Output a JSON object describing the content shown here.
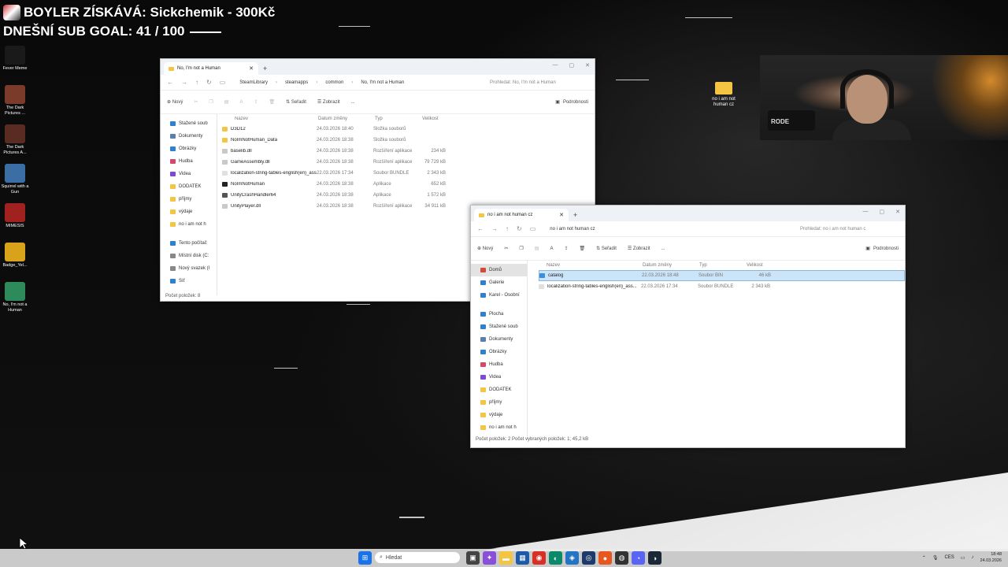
{
  "overlay": {
    "line1": "BOYLER ZÍSKÁVÁ: Sickchemik - 300Kč",
    "line2": "DNEŠNÍ SUB GOAL: 41 / 100"
  },
  "desktop": {
    "icons": [
      {
        "label": "Fever Meme",
        "color": "#1a1a1a"
      },
      {
        "label": "The Dark Pictures ...",
        "color": "#7a3b2a"
      },
      {
        "label": "The Dark Pictures A...",
        "color": "#5a2b22"
      },
      {
        "label": "Squirrel with a Gun",
        "color": "#3a6ea5"
      },
      {
        "label": "MIMESIS",
        "color": "#a12020"
      },
      {
        "label": "Badge_Yel...",
        "color": "#d8a21a"
      },
      {
        "label": "No, I'm not a Human",
        "color": "#2e8a5a"
      }
    ],
    "folder": {
      "label": "no i am not human cz"
    }
  },
  "webcam": {
    "mic_label": "RODE"
  },
  "window1": {
    "tab_title": "No, I'm not a Human",
    "path": [
      "SteamLibrary",
      "steamapps",
      "common",
      "No, I'm not a Human"
    ],
    "search_placeholder": "Prohledat: No, I'm not a Human",
    "toolbar": {
      "new": "Nový",
      "sort": "Seřadit",
      "view": "Zobrazit",
      "more": "...",
      "details": "Podrobnosti"
    },
    "nav": [
      {
        "label": "Stažené soub",
        "color": "#2f80d1"
      },
      {
        "label": "Dokumenty",
        "color": "#5a7fa8"
      },
      {
        "label": "Obrázky",
        "color": "#2f80d1"
      },
      {
        "label": "Hudba",
        "color": "#d34a6a"
      },
      {
        "label": "Videa",
        "color": "#7c4ad3"
      },
      {
        "label": "DODATEK",
        "color": "#f4c542"
      },
      {
        "label": "příjmy",
        "color": "#f4c542"
      },
      {
        "label": "výdaje",
        "color": "#f4c542"
      },
      {
        "label": "no i am not h",
        "color": "#f4c542"
      },
      {
        "label": "Tento počítač",
        "color": "#2f80d1"
      },
      {
        "label": "Místní disk (C:",
        "color": "#888888"
      },
      {
        "label": "Nový svazek (I",
        "color": "#888888"
      },
      {
        "label": "Síť",
        "color": "#2f80d1"
      }
    ],
    "columns": {
      "name": "Název",
      "date": "Datum změny",
      "type": "Typ",
      "size": "Velikost"
    },
    "files": [
      {
        "name": "D3D12",
        "date": "24.03.2026 18:40",
        "type": "Složka souborů",
        "size": "",
        "color": "#f4c542"
      },
      {
        "name": "NoImNotHuman_Data",
        "date": "24.03.2026 18:38",
        "type": "Složka souborů",
        "size": "",
        "color": "#f4c542"
      },
      {
        "name": "baselib.dll",
        "date": "24.03.2026 18:38",
        "type": "Rozšíření aplikace",
        "size": "234 kB",
        "color": "#c9c9c9"
      },
      {
        "name": "GameAssembly.dll",
        "date": "24.03.2026 18:38",
        "type": "Rozšíření aplikace",
        "size": "79 729 kB",
        "color": "#c9c9c9"
      },
      {
        "name": "localization-string-tables-english(en)_ass...",
        "date": "22.03.2026 17:34",
        "type": "Soubor BUNDLE",
        "size": "2 343 kB",
        "color": "#e0e0e0"
      },
      {
        "name": "NoImNotHuman",
        "date": "24.03.2026 18:38",
        "type": "Aplikace",
        "size": "652 kB",
        "color": "#222222"
      },
      {
        "name": "UnityCrashHandler64",
        "date": "24.03.2026 18:38",
        "type": "Aplikace",
        "size": "1 572 kB",
        "color": "#555555"
      },
      {
        "name": "UnityPlayer.dll",
        "date": "24.03.2026 18:38",
        "type": "Rozšíření aplikace",
        "size": "34 911 kB",
        "color": "#c9c9c9"
      }
    ],
    "status": "Počet položek: 8"
  },
  "window2": {
    "tab_title": "no i am not human cz",
    "path": [
      "no i am not human cz"
    ],
    "search_placeholder": "Prohledat: no i am not human c",
    "toolbar": {
      "new": "Nový",
      "sort": "Seřadit",
      "view": "Zobrazit",
      "more": "...",
      "details": "Podrobnosti"
    },
    "nav": [
      {
        "label": "Domů",
        "color": "#d34a3a",
        "selected": true
      },
      {
        "label": "Galerie",
        "color": "#2f80d1"
      },
      {
        "label": "Karel - Osobní",
        "color": "#2f80d1"
      },
      {
        "label": "Plocha",
        "color": "#2f80d1"
      },
      {
        "label": "Stažené soub",
        "color": "#2f80d1"
      },
      {
        "label": "Dokumenty",
        "color": "#5a7fa8"
      },
      {
        "label": "Obrázky",
        "color": "#2f80d1"
      },
      {
        "label": "Hudba",
        "color": "#d34a6a"
      },
      {
        "label": "Videa",
        "color": "#7c4ad3"
      },
      {
        "label": "DODATEK",
        "color": "#f4c542"
      },
      {
        "label": "příjmy",
        "color": "#f4c542"
      },
      {
        "label": "výdaje",
        "color": "#f4c542"
      },
      {
        "label": "no i am not h",
        "color": "#f4c542"
      }
    ],
    "columns": {
      "name": "Název",
      "date": "Datum změny",
      "type": "Typ",
      "size": "Velikost"
    },
    "files": [
      {
        "name": "catalog",
        "date": "22.03.2026 18:48",
        "type": "Soubor BIN",
        "size": "46 kB",
        "color": "#3a8ee0",
        "selected": true
      },
      {
        "name": "localization-string-tables-english(en)_ass...",
        "date": "22.03.2026 17:34",
        "type": "Soubor BUNDLE",
        "size": "2 343 kB",
        "color": "#e0e0e0"
      }
    ],
    "status": "Počet položek: 2    Počet vybraných položek: 1; 45,2 kB"
  },
  "taskbar": {
    "search_placeholder": "Hledat",
    "lang": "CES",
    "time": "18:48",
    "date": "24.03.2026"
  }
}
